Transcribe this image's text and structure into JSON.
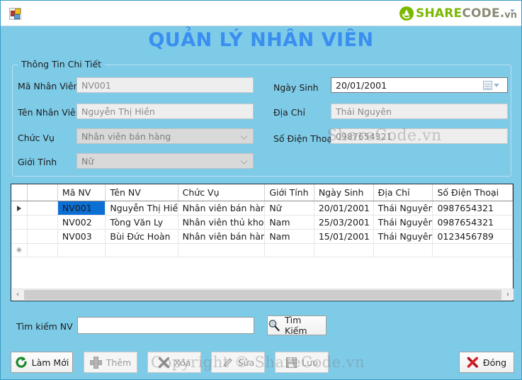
{
  "window": {
    "app_icon": "app-window-icon",
    "brand": {
      "share": "SHARE",
      "code": "CODE",
      "dot": ".",
      "vn": "vn"
    }
  },
  "page_title": "QUẢN LÝ NHÂN VIÊN",
  "groupbox": {
    "title": "Thông Tin Chi Tiết",
    "fields": {
      "ma_nv": {
        "label": "Mã Nhân Viên",
        "value": "NV001"
      },
      "ten_nv": {
        "label": "Tên Nhân Viên",
        "value": "Nguyễn Thị Hiền"
      },
      "chuc_vu": {
        "label": "Chức Vụ",
        "value": "Nhân viên bán hàng"
      },
      "gioi_tinh": {
        "label": "Giới Tính",
        "value": "Nữ"
      },
      "ngay_sinh": {
        "label": "Ngày Sinh",
        "value": "20/01/2001"
      },
      "dia_chi": {
        "label": "Địa Chỉ",
        "value": "Thái Nguyên"
      },
      "so_dien_thoai": {
        "label": "Số Điện Thoại",
        "value": "0987654321"
      }
    }
  },
  "grid": {
    "columns": [
      "Mã NV",
      "Tên NV",
      "Chức Vụ",
      "Giới Tính",
      "Ngày Sinh",
      "Địa Chỉ",
      "Số Điện Thoại"
    ],
    "rows": [
      {
        "marker": "current-row",
        "selected": true,
        "cells": [
          "NV001",
          "Nguyễn Thị Hiền",
          "Nhân viên bán hàng",
          "Nữ",
          "20/01/2001",
          "Thái Nguyên",
          "0987654321"
        ]
      },
      {
        "marker": "",
        "selected": false,
        "cells": [
          "NV002",
          "Tòng Văn Ly",
          "Nhân viên thủ kho",
          "Nam",
          "25/03/2001",
          "Thái Nguyên",
          "0987654321"
        ]
      },
      {
        "marker": "",
        "selected": false,
        "cells": [
          "NV003",
          "Bùi Đức Hoàn",
          "Nhân viên bán hàng",
          "Nam",
          "15/01/2001",
          "Thái Nguyên",
          "0123456789"
        ]
      },
      {
        "marker": "new-row",
        "selected": false,
        "cells": [
          "",
          "",
          "",
          "",
          "",
          "",
          ""
        ]
      }
    ],
    "scroll_left_arrow": "‹",
    "scroll_right_arrow": "›"
  },
  "search": {
    "label": "Tìm kiếm NV",
    "value": "",
    "placeholder": "",
    "button": "Tìm Kiếm"
  },
  "buttons": {
    "lam_moi": "Làm Mới",
    "them": "Thêm",
    "xoa": "Xóa",
    "sua": "Sửa",
    "luu": "Lưu",
    "dong": "Đóng"
  },
  "watermarks": {
    "center_top": "ShareCode.vn",
    "bottom": "Copyright © ShareCode.vn"
  },
  "colors": {
    "form_background": "#7ecbe8",
    "title_text": "#3a8ef0",
    "grid_selection": "#0c6fd4",
    "brand_green": "#7ab800",
    "brand_grey": "#8a8a78"
  }
}
